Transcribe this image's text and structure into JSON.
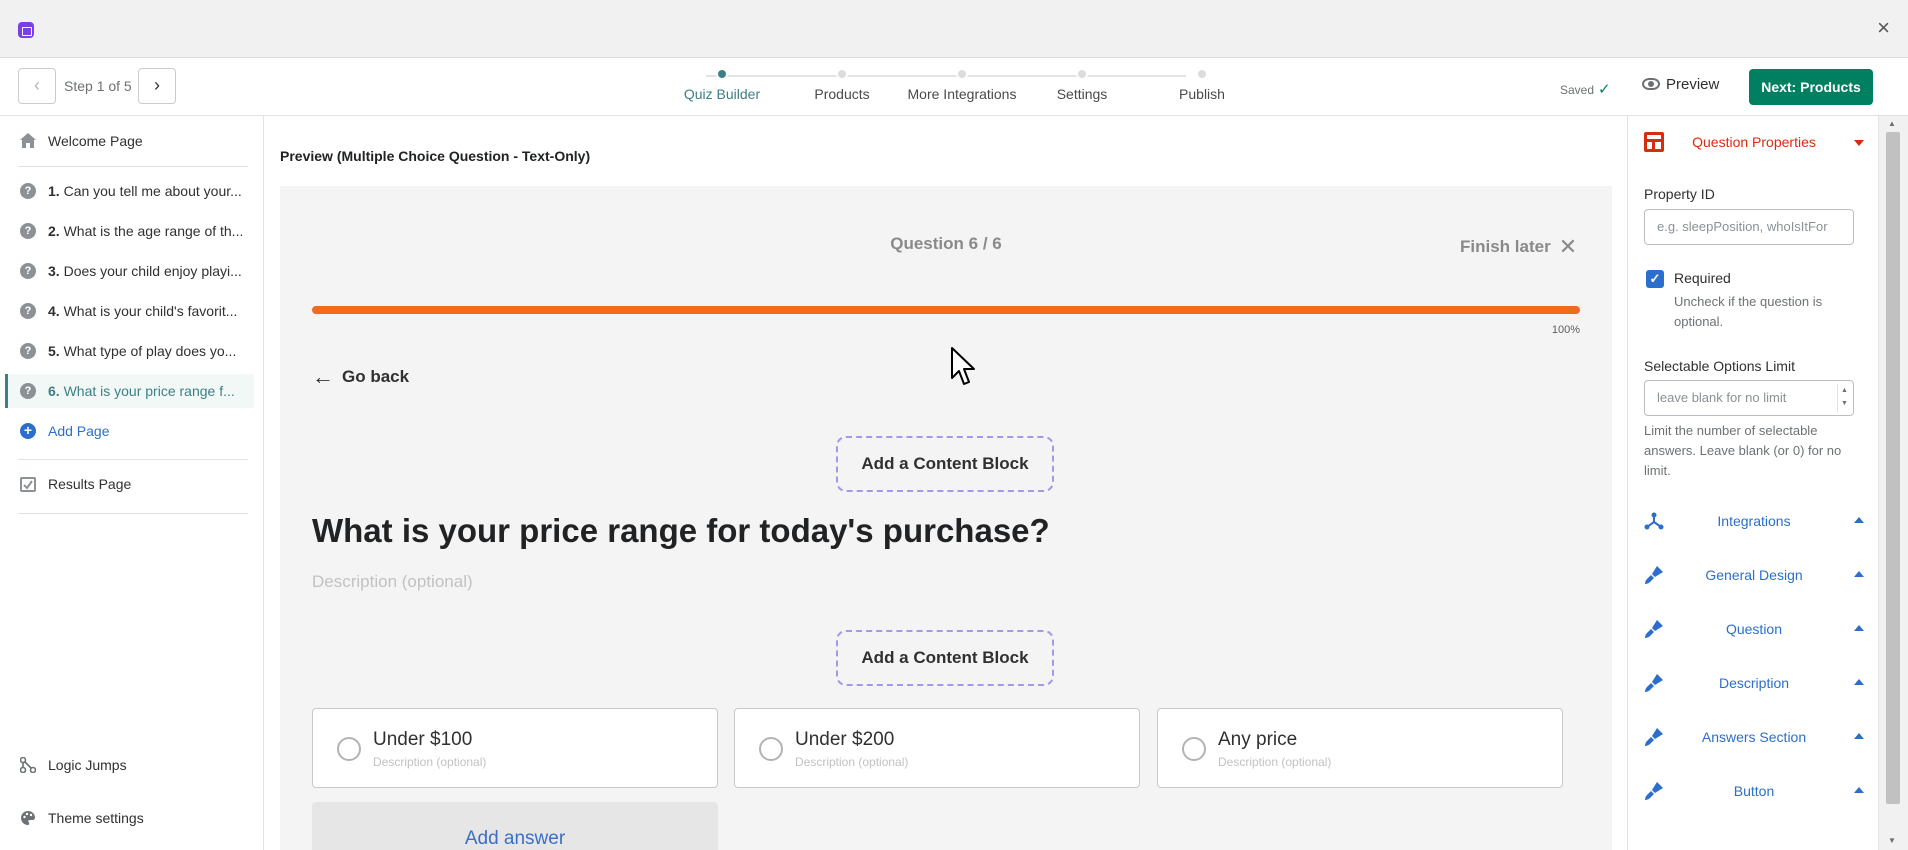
{
  "window": {
    "close_glyph": "×"
  },
  "topbar": {
    "prev_glyph": "‹",
    "next_glyph": "›",
    "step_label": "Step 1 of 5",
    "steps": [
      {
        "label": "Quiz Builder",
        "active": true
      },
      {
        "label": "Products",
        "active": false
      },
      {
        "label": "More Integrations",
        "active": false
      },
      {
        "label": "Settings",
        "active": false
      },
      {
        "label": "Publish",
        "active": false
      }
    ],
    "saved_label": "Saved",
    "saved_check": "✓",
    "preview_label": "Preview",
    "next_button": "Next: Products"
  },
  "sidebar": {
    "welcome": "Welcome Page",
    "questions": [
      {
        "num": "1.",
        "text": "Can you tell me about your..."
      },
      {
        "num": "2.",
        "text": "What is the age range of th..."
      },
      {
        "num": "3.",
        "text": "Does your child enjoy playi..."
      },
      {
        "num": "4.",
        "text": "What is your child's favorit..."
      },
      {
        "num": "5.",
        "text": "What type of play does yo..."
      },
      {
        "num": "6.",
        "text": "What is your price range f..."
      }
    ],
    "question_icon": "?",
    "add_page": "Add Page",
    "results": "Results Page",
    "logic_jumps": "Logic Jumps",
    "theme_settings": "Theme settings"
  },
  "preview": {
    "title": "Preview (Multiple Choice Question - Text-Only)",
    "counter": "Question 6 / 6",
    "finish_later": "Finish later",
    "finish_glyph": "✕",
    "progress": 1.0,
    "progress_label": "100%",
    "go_back": "Go back",
    "back_arrow": "←",
    "content_block": "Add a Content Block",
    "question": "What is your price range for today's purchase?",
    "description_placeholder": "Description (optional)",
    "answers": [
      {
        "label": "Under $100",
        "desc": "Description (optional)"
      },
      {
        "label": "Under $200",
        "desc": "Description (optional)"
      },
      {
        "label": "Any price",
        "desc": "Description (optional)"
      }
    ],
    "add_answer": "Add answer"
  },
  "properties": {
    "header": "Question Properties",
    "property_id_label": "Property ID",
    "property_id_placeholder": "e.g. sleepPosition, whoIsItFor",
    "required_label": "Required",
    "required_checked": true,
    "required_help_1": "Uncheck if the question is",
    "required_help_2": "optional.",
    "limit_label": "Selectable Options Limit",
    "limit_placeholder": "leave blank for no limit",
    "limit_help_1": "Limit the number of selectable",
    "limit_help_2": "answers. Leave blank (or 0) for no",
    "limit_help_3": "limit.",
    "sections": [
      {
        "label": "Integrations",
        "icon": "integrations-icon"
      },
      {
        "label": "General Design",
        "icon": "brush-icon"
      },
      {
        "label": "Question",
        "icon": "brush-icon"
      },
      {
        "label": "Description",
        "icon": "brush-icon"
      },
      {
        "label": "Answers Section",
        "icon": "brush-icon"
      },
      {
        "label": "Button",
        "icon": "brush-icon"
      }
    ]
  },
  "colors": {
    "accent_teal": "#3e7f86",
    "primary_green": "#008060",
    "progress_orange": "#f26b1d",
    "link_blue": "#2c6ecb",
    "critical_red": "#d72c0d"
  }
}
